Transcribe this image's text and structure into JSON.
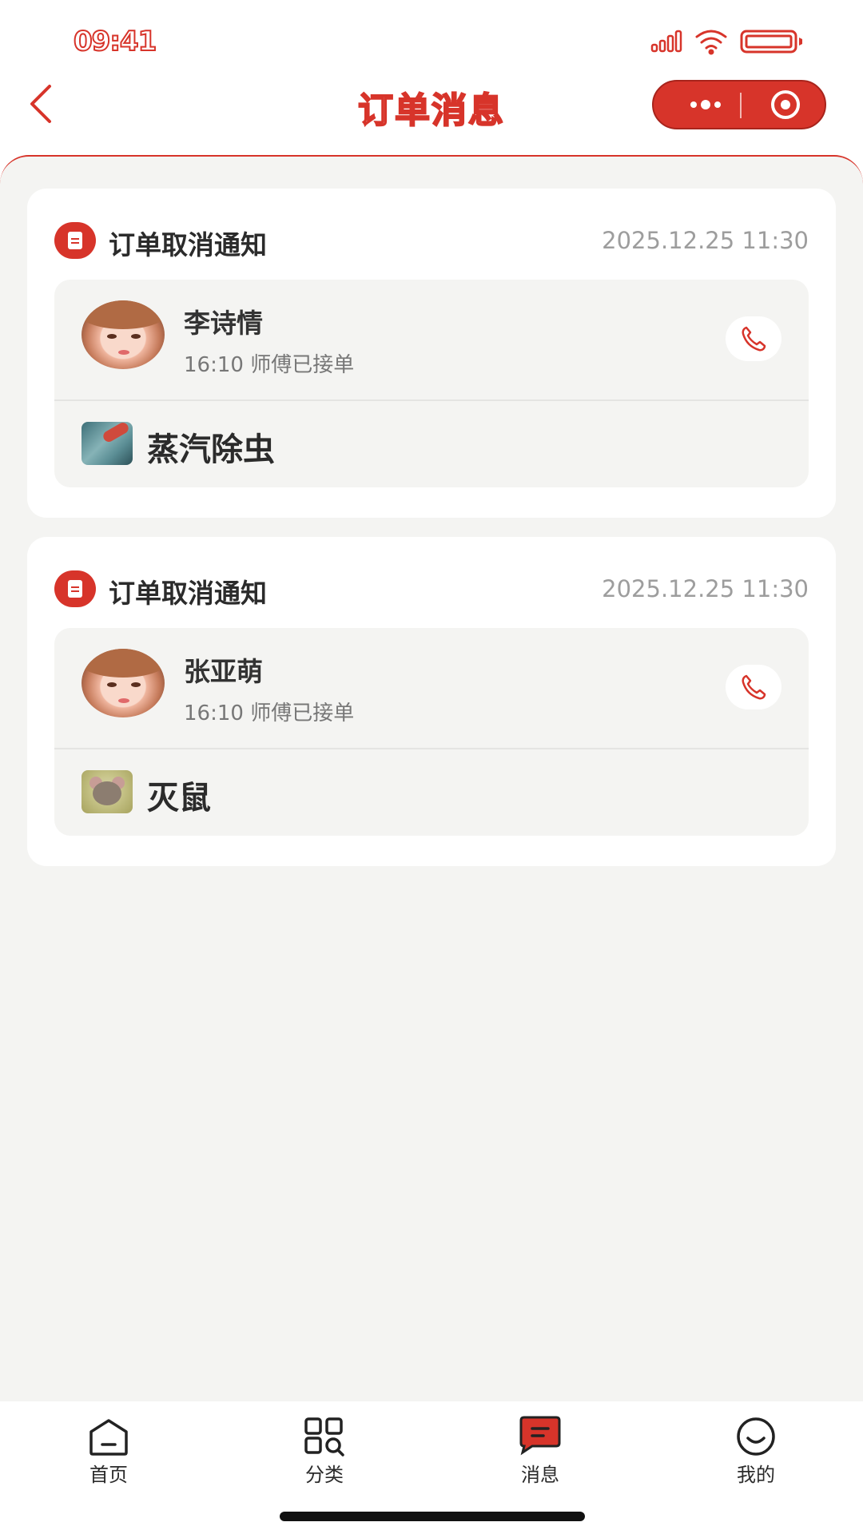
{
  "status_bar": {
    "time": "09:41"
  },
  "nav": {
    "title": "订单消息"
  },
  "colors": {
    "accent": "#d7342a",
    "background": "#f4f4f2"
  },
  "messages": [
    {
      "title": "订单取消通知",
      "time": "2025.12.25 11:30",
      "name": "李诗情",
      "status": "16:10 师傅已接单",
      "service": "蒸汽除虫"
    },
    {
      "title": "订单取消通知",
      "time": "2025.12.25 11:30",
      "name": "张亚萌",
      "status": "16:10 师傅已接单",
      "service": "灭鼠"
    }
  ],
  "tabs": [
    {
      "label": "首页",
      "icon": "home-icon"
    },
    {
      "label": "分类",
      "icon": "category-icon"
    },
    {
      "label": "消息",
      "icon": "message-icon",
      "active": true
    },
    {
      "label": "我的",
      "icon": "profile-icon"
    }
  ]
}
